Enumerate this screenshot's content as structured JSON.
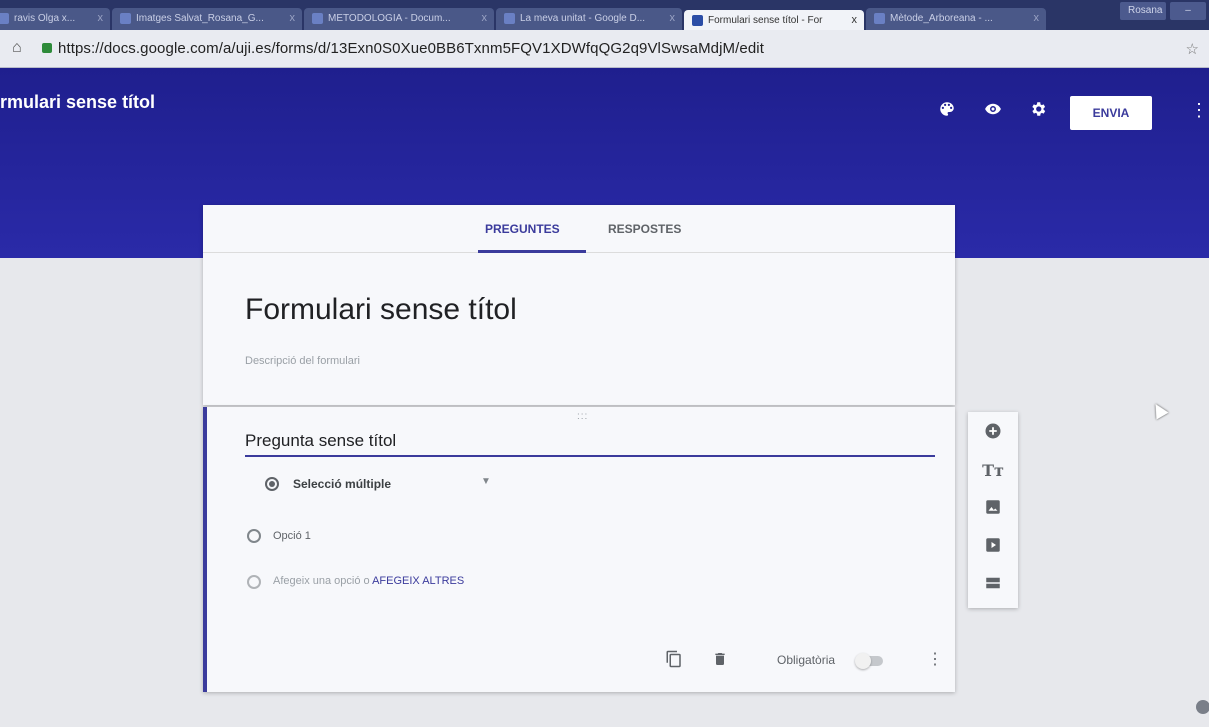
{
  "browser": {
    "tabs": [
      {
        "label": "ravis Olga x...",
        "active": false
      },
      {
        "label": "Imatges Salvat_Rosana_G...",
        "active": false
      },
      {
        "label": "METODOLOGIA - Docum...",
        "active": false
      },
      {
        "label": "La meva unitat - Google D...",
        "active": false
      },
      {
        "label": "Formulari sense títol - For",
        "active": true
      },
      {
        "label": "Mètode_Arboreana - ...",
        "active": false
      }
    ],
    "close_glyph": "x",
    "profile_label": "Rosana",
    "url": "https://docs.google.com/a/uji.es/forms/d/13Exn0S0Xue0BB6Txnm5FQV1XDWfqQG2q9VlSwsaMdjM/edit"
  },
  "header": {
    "title": "rmulari sense títol",
    "send_label": "ENVIA",
    "icons": [
      "palette-icon",
      "eye-icon",
      "gear-icon",
      "more-vert-icon"
    ]
  },
  "form": {
    "tabs": [
      {
        "label": "PREGUNTES",
        "active": true
      },
      {
        "label": "RESPOSTES",
        "active": false
      }
    ],
    "title": "Formulari sense títol",
    "description_placeholder": "Descripció del formulari"
  },
  "question": {
    "drag_handle": ":::",
    "title": "Pregunta sense títol",
    "type_label": "Selecció múltiple",
    "option_1": "Opció 1",
    "add_option_text": "Afegeix una opció",
    "add_option_connector": "o",
    "add_other_text": "AFEGEIX ALTRES",
    "required_label": "Obligatòria",
    "required_on": false
  },
  "side_toolbar": [
    "add-question-icon",
    "title-text-icon",
    "image-icon",
    "video-icon",
    "section-icon"
  ],
  "colors": {
    "header_bg": "#20209a",
    "accent": "#3b3b9c",
    "background": "#e7e8ec"
  }
}
